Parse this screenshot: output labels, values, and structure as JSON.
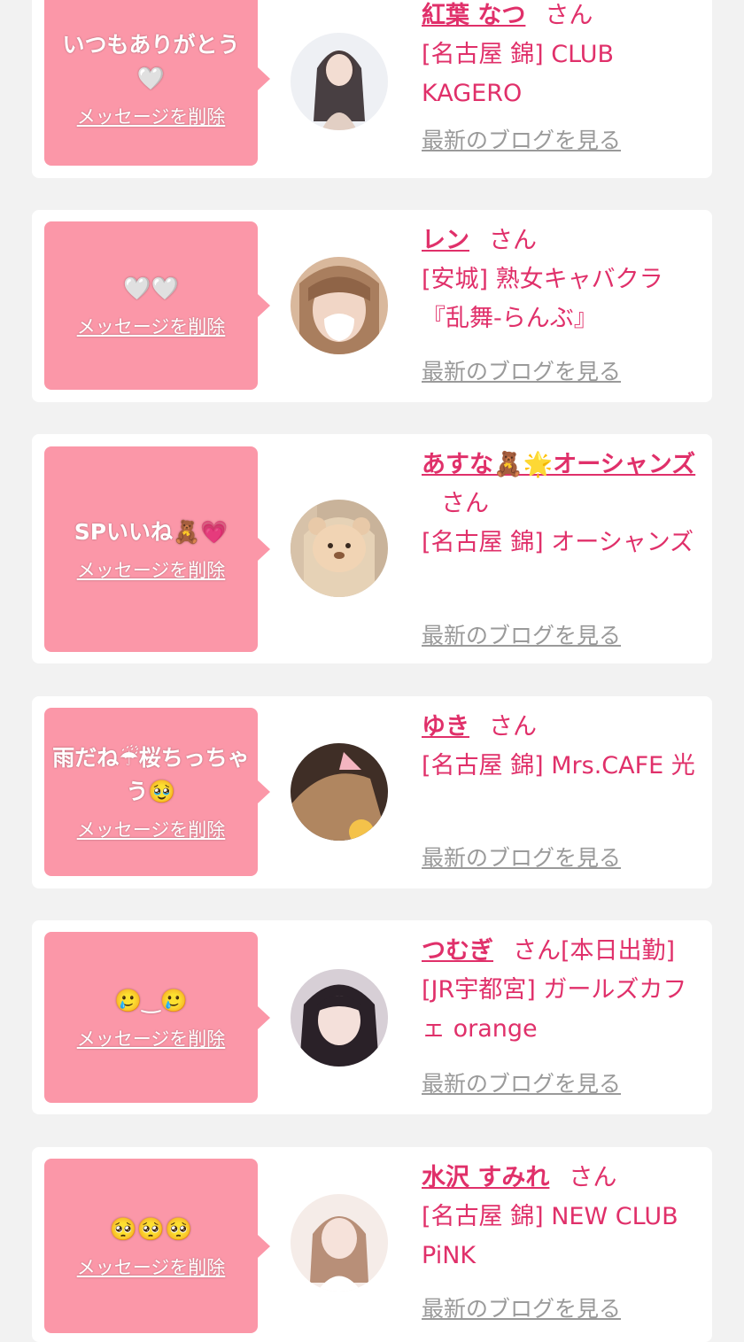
{
  "cards": [
    {
      "message": "いつもありがとう🤍",
      "delete_label": "メッセージを削除",
      "name": "紅葉 なつ",
      "honorific": "さん",
      "shop": "[名古屋 錦] CLUB KAGERO",
      "blog_label": "最新のブログを見る",
      "avatar_color": "#e8ddd8"
    },
    {
      "message": "🤍🤍",
      "delete_label": "メッセージを削除",
      "name": "レン",
      "honorific": "さん",
      "shop": "[安城] 熟女キャバクラ『乱舞-らんぶ』",
      "blog_label": "最新のブログを見る",
      "avatar_color": "#c9a48a"
    },
    {
      "message": "SPいいね🧸💗",
      "delete_label": "メッセージを削除",
      "name": "あすな🧸🌟オーシャンズ",
      "honorific": "さん",
      "shop": "[名古屋 錦] オーシャンズ",
      "blog_label": "最新のブログを見る",
      "avatar_color": "#d9c7b0"
    },
    {
      "message": "雨だね☔桜ちっちゃう🥹",
      "delete_label": "メッセージを削除",
      "name": "ゆき",
      "honorific": "さん",
      "shop": "[名古屋 錦] Mrs.CAFE 光",
      "blog_label": "最新のブログを見る",
      "avatar_color": "#8b6a50"
    },
    {
      "message": "🥲‿🥲",
      "delete_label": "メッセージを削除",
      "name": "つむぎ",
      "honorific": "さん[本日出勤]",
      "shop": "[JR宇都宮] ガールズカフェ orange",
      "blog_label": "最新のブログを見る",
      "avatar_color": "#3a2f35"
    },
    {
      "message": "🥺🥺🥺",
      "delete_label": "メッセージを削除",
      "name": "水沢 すみれ",
      "honorific": "さん",
      "shop": "[名古屋 錦] NEW CLUB PiNK",
      "blog_label": "最新のブログを見る",
      "avatar_color": "#f0e0dc"
    }
  ]
}
